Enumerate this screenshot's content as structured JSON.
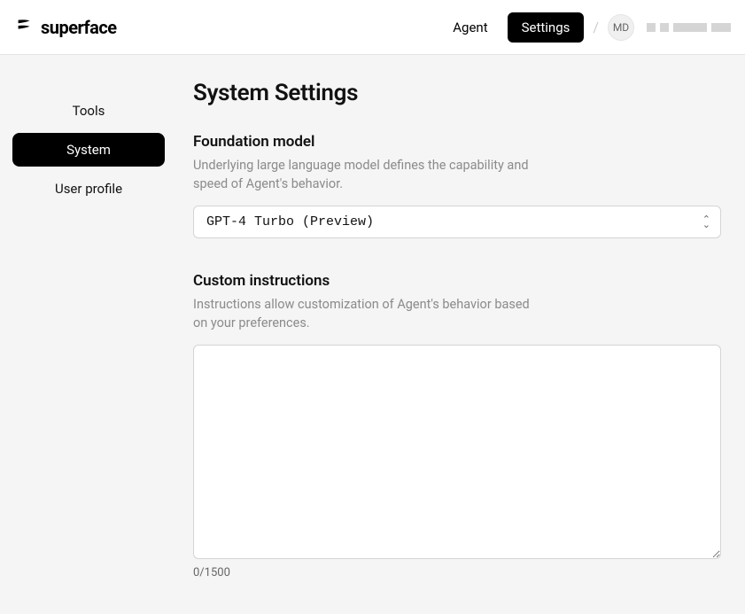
{
  "brand": {
    "name": "superface"
  },
  "nav": {
    "agent": "Agent",
    "settings": "Settings"
  },
  "user": {
    "initials": "MD"
  },
  "sidebar": {
    "items": [
      {
        "label": "Tools"
      },
      {
        "label": "System"
      },
      {
        "label": "User profile"
      }
    ]
  },
  "page": {
    "title": "System Settings"
  },
  "foundation": {
    "title": "Foundation model",
    "desc": "Underlying large language model defines the capability and speed of Agent's behavior.",
    "selected": "GPT-4 Turbo (Preview)"
  },
  "instructions": {
    "title": "Custom instructions",
    "desc": "Instructions allow customization of Agent's behavior based on your preferences.",
    "value": "",
    "counter": "0/1500"
  }
}
